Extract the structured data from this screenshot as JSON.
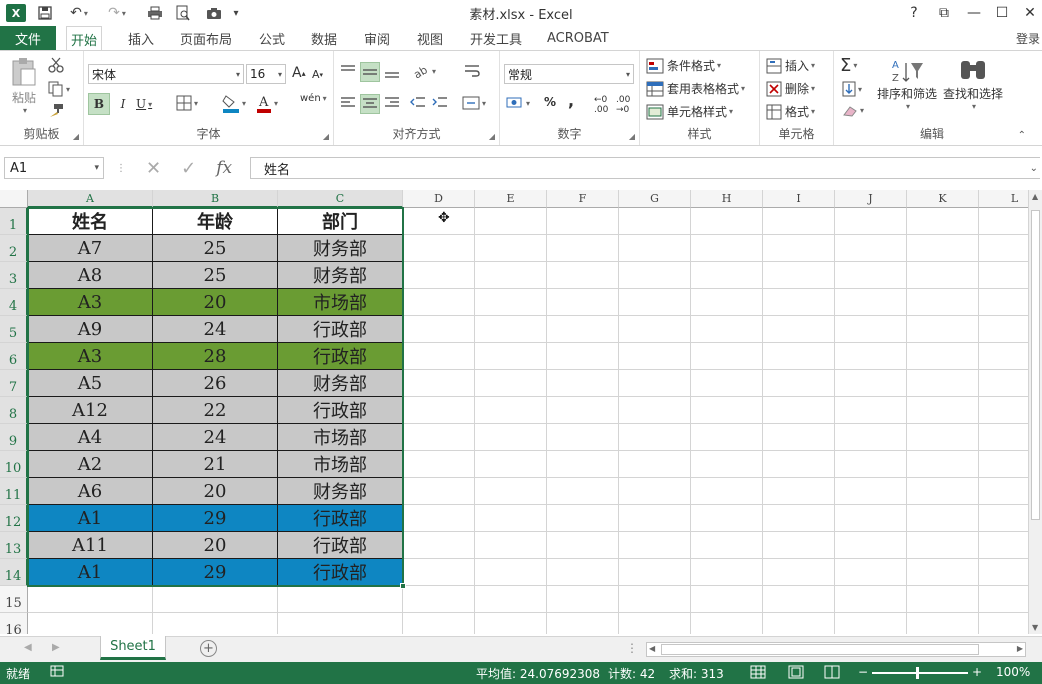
{
  "titlebar": {
    "title": "素材.xlsx - Excel",
    "help": "?",
    "restore": "⧉",
    "minimize": "—",
    "maximize": "☐",
    "close": "✕"
  },
  "quick_access": {
    "save": "💾",
    "undo": "↶",
    "redo": "↷",
    "more": "▾"
  },
  "tabs": {
    "file": "文件",
    "items": [
      "开始",
      "插入",
      "页面布局",
      "公式",
      "数据",
      "审阅",
      "视图",
      "开发工具",
      "ACROBAT"
    ],
    "active_index": 0,
    "login": "登录"
  },
  "ribbon": {
    "clipboard": {
      "label": "剪贴板",
      "paste": "粘贴"
    },
    "font": {
      "label": "字体",
      "name": "宋体",
      "size": "16",
      "bold": "B",
      "italic": "I",
      "underline": "U",
      "grow": "A",
      "shrink": "A"
    },
    "alignment": {
      "label": "对齐方式"
    },
    "number": {
      "label": "数字",
      "format": "常规",
      "percent": "%",
      "comma": ","
    },
    "styles": {
      "label": "样式",
      "conditional": "条件格式",
      "table": "套用表格格式",
      "cell": "单元格样式"
    },
    "cells": {
      "label": "单元格",
      "insert": "插入",
      "delete": "删除",
      "format": "格式"
    },
    "editing": {
      "label": "编辑",
      "sort": "排序和筛选",
      "find": "查找和选择"
    }
  },
  "formula_bar": {
    "name_box": "A1",
    "fx": "fx",
    "content": "姓名"
  },
  "columns": [
    "A",
    "B",
    "C",
    "D",
    "E",
    "F",
    "G",
    "H",
    "I",
    "J",
    "K",
    "L"
  ],
  "rows": [
    "1",
    "2",
    "3",
    "4",
    "5",
    "6",
    "7",
    "8",
    "9",
    "10",
    "11",
    "12",
    "13",
    "14",
    "15",
    "16"
  ],
  "table": {
    "headers": [
      "姓名",
      "年龄",
      "部门"
    ],
    "rows": [
      {
        "name": "A7",
        "age": "25",
        "dept": "财务部",
        "color": "#c8c8c8"
      },
      {
        "name": "A8",
        "age": "25",
        "dept": "财务部",
        "color": "#c8c8c8"
      },
      {
        "name": "A3",
        "age": "20",
        "dept": "市场部",
        "color": "#6a9c33"
      },
      {
        "name": "A9",
        "age": "24",
        "dept": "行政部",
        "color": "#c8c8c8"
      },
      {
        "name": "A3",
        "age": "28",
        "dept": "行政部",
        "color": "#6a9c33"
      },
      {
        "name": "A5",
        "age": "26",
        "dept": "财务部",
        "color": "#c8c8c8"
      },
      {
        "name": "A12",
        "age": "22",
        "dept": "行政部",
        "color": "#c8c8c8"
      },
      {
        "name": "A4",
        "age": "24",
        "dept": "市场部",
        "color": "#c8c8c8"
      },
      {
        "name": "A2",
        "age": "21",
        "dept": "市场部",
        "color": "#c8c8c8"
      },
      {
        "name": "A6",
        "age": "20",
        "dept": "财务部",
        "color": "#c8c8c8"
      },
      {
        "name": "A1",
        "age": "29",
        "dept": "行政部",
        "color": "#0e86c2"
      },
      {
        "name": "A11",
        "age": "20",
        "dept": "行政部",
        "color": "#c8c8c8"
      },
      {
        "name": "A1",
        "age": "29",
        "dept": "行政部",
        "color": "#0e86c2"
      }
    ]
  },
  "sheet": {
    "tab": "Sheet1",
    "add": "+"
  },
  "status": {
    "ready": "就绪",
    "average": "平均值: 24.07692308",
    "count": "计数: 42",
    "sum": "求和: 313",
    "zoom": "100%"
  },
  "colors": {
    "accent": "#217346"
  }
}
